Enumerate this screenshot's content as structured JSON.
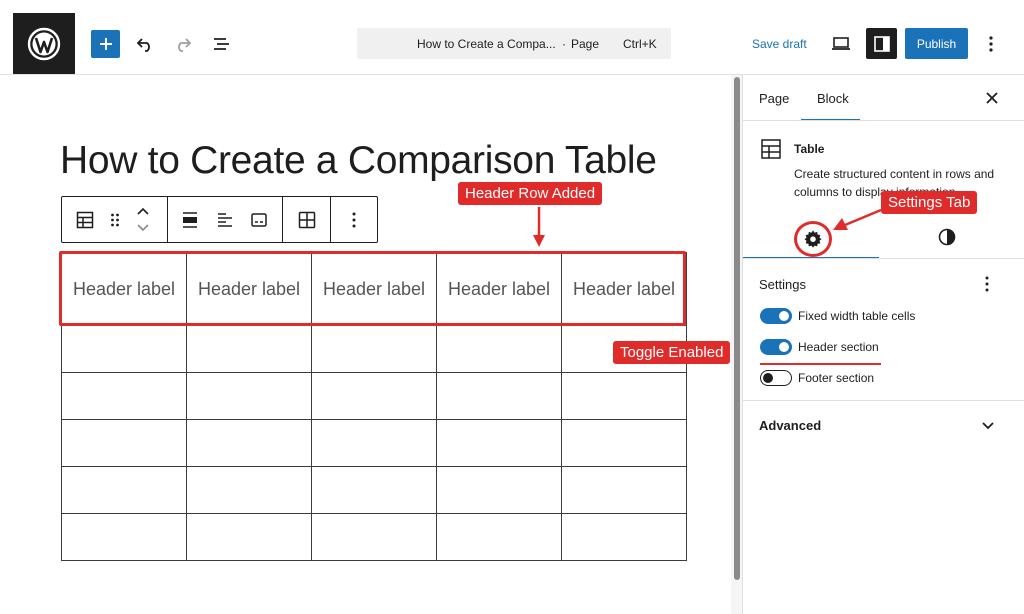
{
  "topbar": {
    "command_title": "How to Create a Compa...",
    "command_separator": "·",
    "command_type": "Page",
    "command_shortcut": "Ctrl+K",
    "save_draft": "Save draft",
    "publish": "Publish"
  },
  "editor": {
    "title": "How to Create a Comparison Table",
    "table": {
      "headers": [
        "Header label",
        "Header label",
        "Header label",
        "Header label",
        "Header label"
      ],
      "body_rows": 5
    }
  },
  "callouts": {
    "header_row": "Header Row Added",
    "settings_tab": "Settings Tab",
    "toggle": "Toggle Enabled"
  },
  "sidebar": {
    "tabs": [
      {
        "label": "Page",
        "active": false
      },
      {
        "label": "Block",
        "active": true
      }
    ],
    "block": {
      "name": "Table",
      "description": "Create structured content in rows and columns to display information."
    },
    "settings_title": "Settings",
    "toggles": [
      {
        "label": "Fixed width table cells",
        "on": true
      },
      {
        "label": "Header section",
        "on": true
      },
      {
        "label": "Footer section",
        "on": false
      }
    ],
    "advanced": "Advanced"
  },
  "colors": {
    "accent": "#1a73b8",
    "annotation": "#e02b2b",
    "dark": "#1e1e1e"
  }
}
